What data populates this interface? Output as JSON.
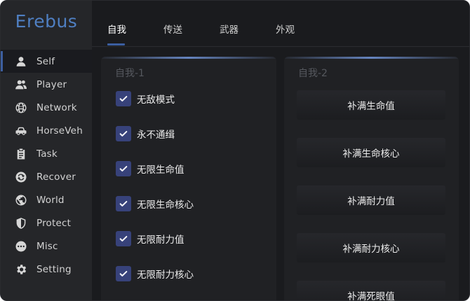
{
  "app": {
    "brand": "Erebus"
  },
  "sidebar": {
    "items": [
      {
        "label": "Self",
        "icon": "person-icon",
        "active": true
      },
      {
        "label": "Player",
        "icon": "users-icon",
        "active": false
      },
      {
        "label": "Network",
        "icon": "globe-grid-icon",
        "active": false
      },
      {
        "label": "HorseVeh",
        "icon": "car-icon",
        "active": false
      },
      {
        "label": "Task",
        "icon": "clipboard-icon",
        "active": false
      },
      {
        "label": "Recover",
        "icon": "refresh-icon",
        "active": false
      },
      {
        "label": "World",
        "icon": "earth-icon",
        "active": false
      },
      {
        "label": "Protect",
        "icon": "shield-icon",
        "active": false
      },
      {
        "label": "Misc",
        "icon": "more-dots-icon",
        "active": false
      },
      {
        "label": "Setting",
        "icon": "gear-icon",
        "active": false
      }
    ]
  },
  "tabs": [
    {
      "label": "自我",
      "active": true
    },
    {
      "label": "传送",
      "active": false
    },
    {
      "label": "武器",
      "active": false
    },
    {
      "label": "外观",
      "active": false
    }
  ],
  "panel1": {
    "title": "自我-1",
    "options": [
      {
        "label": "无敌模式",
        "checked": true
      },
      {
        "label": "永不通缉",
        "checked": true
      },
      {
        "label": "无限生命值",
        "checked": true
      },
      {
        "label": "无限生命核心",
        "checked": true
      },
      {
        "label": "无限耐力值",
        "checked": true
      },
      {
        "label": "无限耐力核心",
        "checked": true
      }
    ]
  },
  "panel2": {
    "title": "自我-2",
    "buttons": [
      {
        "label": "补满生命值"
      },
      {
        "label": "补满生命核心"
      },
      {
        "label": "补满耐力值"
      },
      {
        "label": "补满耐力核心"
      },
      {
        "label": "补满死眼值"
      }
    ]
  },
  "colors": {
    "accent": "#3b5ea0",
    "brand": "#4f7fc2",
    "checkbox": "#37427a",
    "background": "#1a1b1e",
    "sidebar": "#252629"
  }
}
